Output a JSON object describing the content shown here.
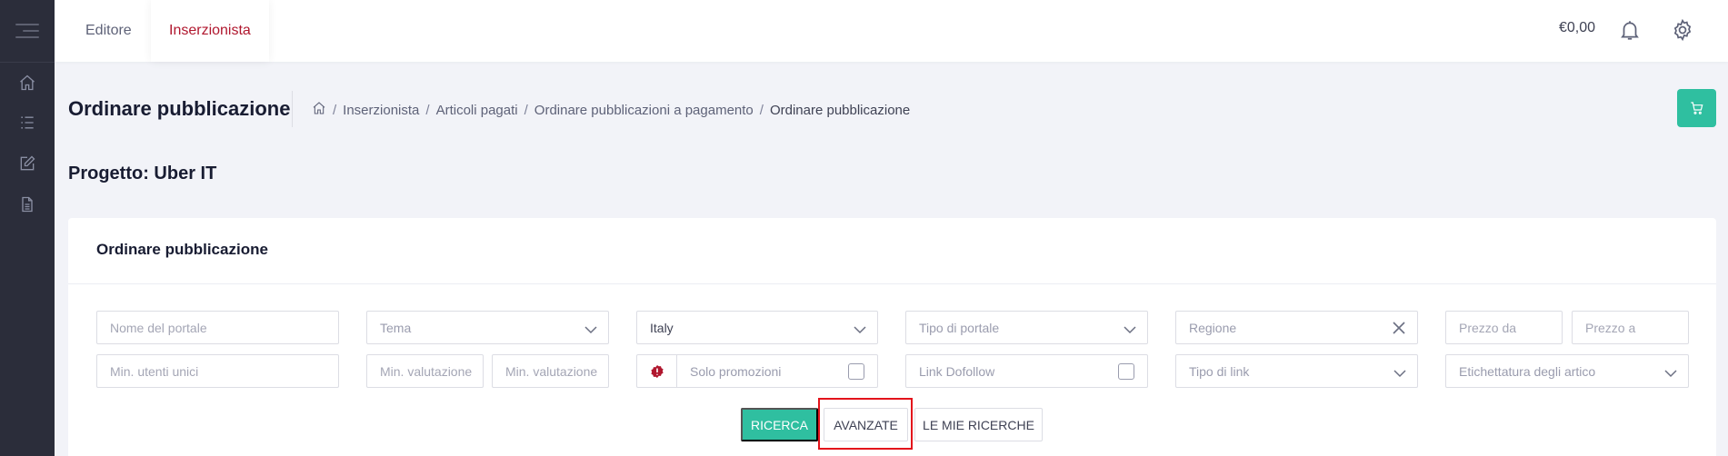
{
  "header": {
    "tabs": [
      {
        "label": "Editore",
        "active": false
      },
      {
        "label": "Inserzionista",
        "active": true
      }
    ],
    "balance": "€0,00",
    "icons": [
      "bell-icon",
      "gear-icon"
    ]
  },
  "sidebar": {
    "items": [
      {
        "icon": "menu-icon"
      },
      {
        "icon": "home-icon"
      },
      {
        "icon": "list-icon"
      },
      {
        "icon": "edit-icon"
      },
      {
        "icon": "document-icon"
      }
    ]
  },
  "subheader": {
    "title": "Ordinare pubblicazione",
    "breadcrumb": [
      {
        "label": "Inserzionista"
      },
      {
        "label": "Articoli pagati"
      },
      {
        "label": "Ordinare pubblicazioni a pagamento"
      },
      {
        "label": "Ordinare pubblicazione"
      }
    ],
    "separator": "/"
  },
  "project": {
    "title": "Progetto: Uber IT"
  },
  "card": {
    "title": "Ordinare pubblicazione",
    "filters": {
      "portal_name": {
        "placeholder": "Nome del portale"
      },
      "theme": {
        "placeholder": "Tema"
      },
      "country": {
        "value": "Italy"
      },
      "portal_type": {
        "placeholder": "Tipo di portale"
      },
      "region": {
        "placeholder": "Regione"
      },
      "price_from": {
        "placeholder": "Prezzo da"
      },
      "price_to": {
        "placeholder": "Prezzo a"
      },
      "min_unique_users": {
        "placeholder": "Min. utenti unici"
      },
      "min_rating_1": {
        "placeholder": "Min. valutazione"
      },
      "min_rating_2": {
        "placeholder": "Min. valutazione"
      },
      "promotions_only": {
        "label": "Solo promozioni",
        "checked": false
      },
      "dofollow_link": {
        "label": "Link Dofollow",
        "checked": false
      },
      "link_type": {
        "placeholder": "Tipo di link"
      },
      "article_labeling": {
        "placeholder": "Etichettatura degli artico"
      }
    },
    "buttons": {
      "search": "RICERCA",
      "advanced": "AVANZATE",
      "my_searches": "LE MIE RICERCHE"
    }
  },
  "colors": {
    "accent": "#2fbfa0",
    "active_tab": "#b0172e",
    "sidebar": "#2b2d3a",
    "highlight": "#e3131b"
  }
}
